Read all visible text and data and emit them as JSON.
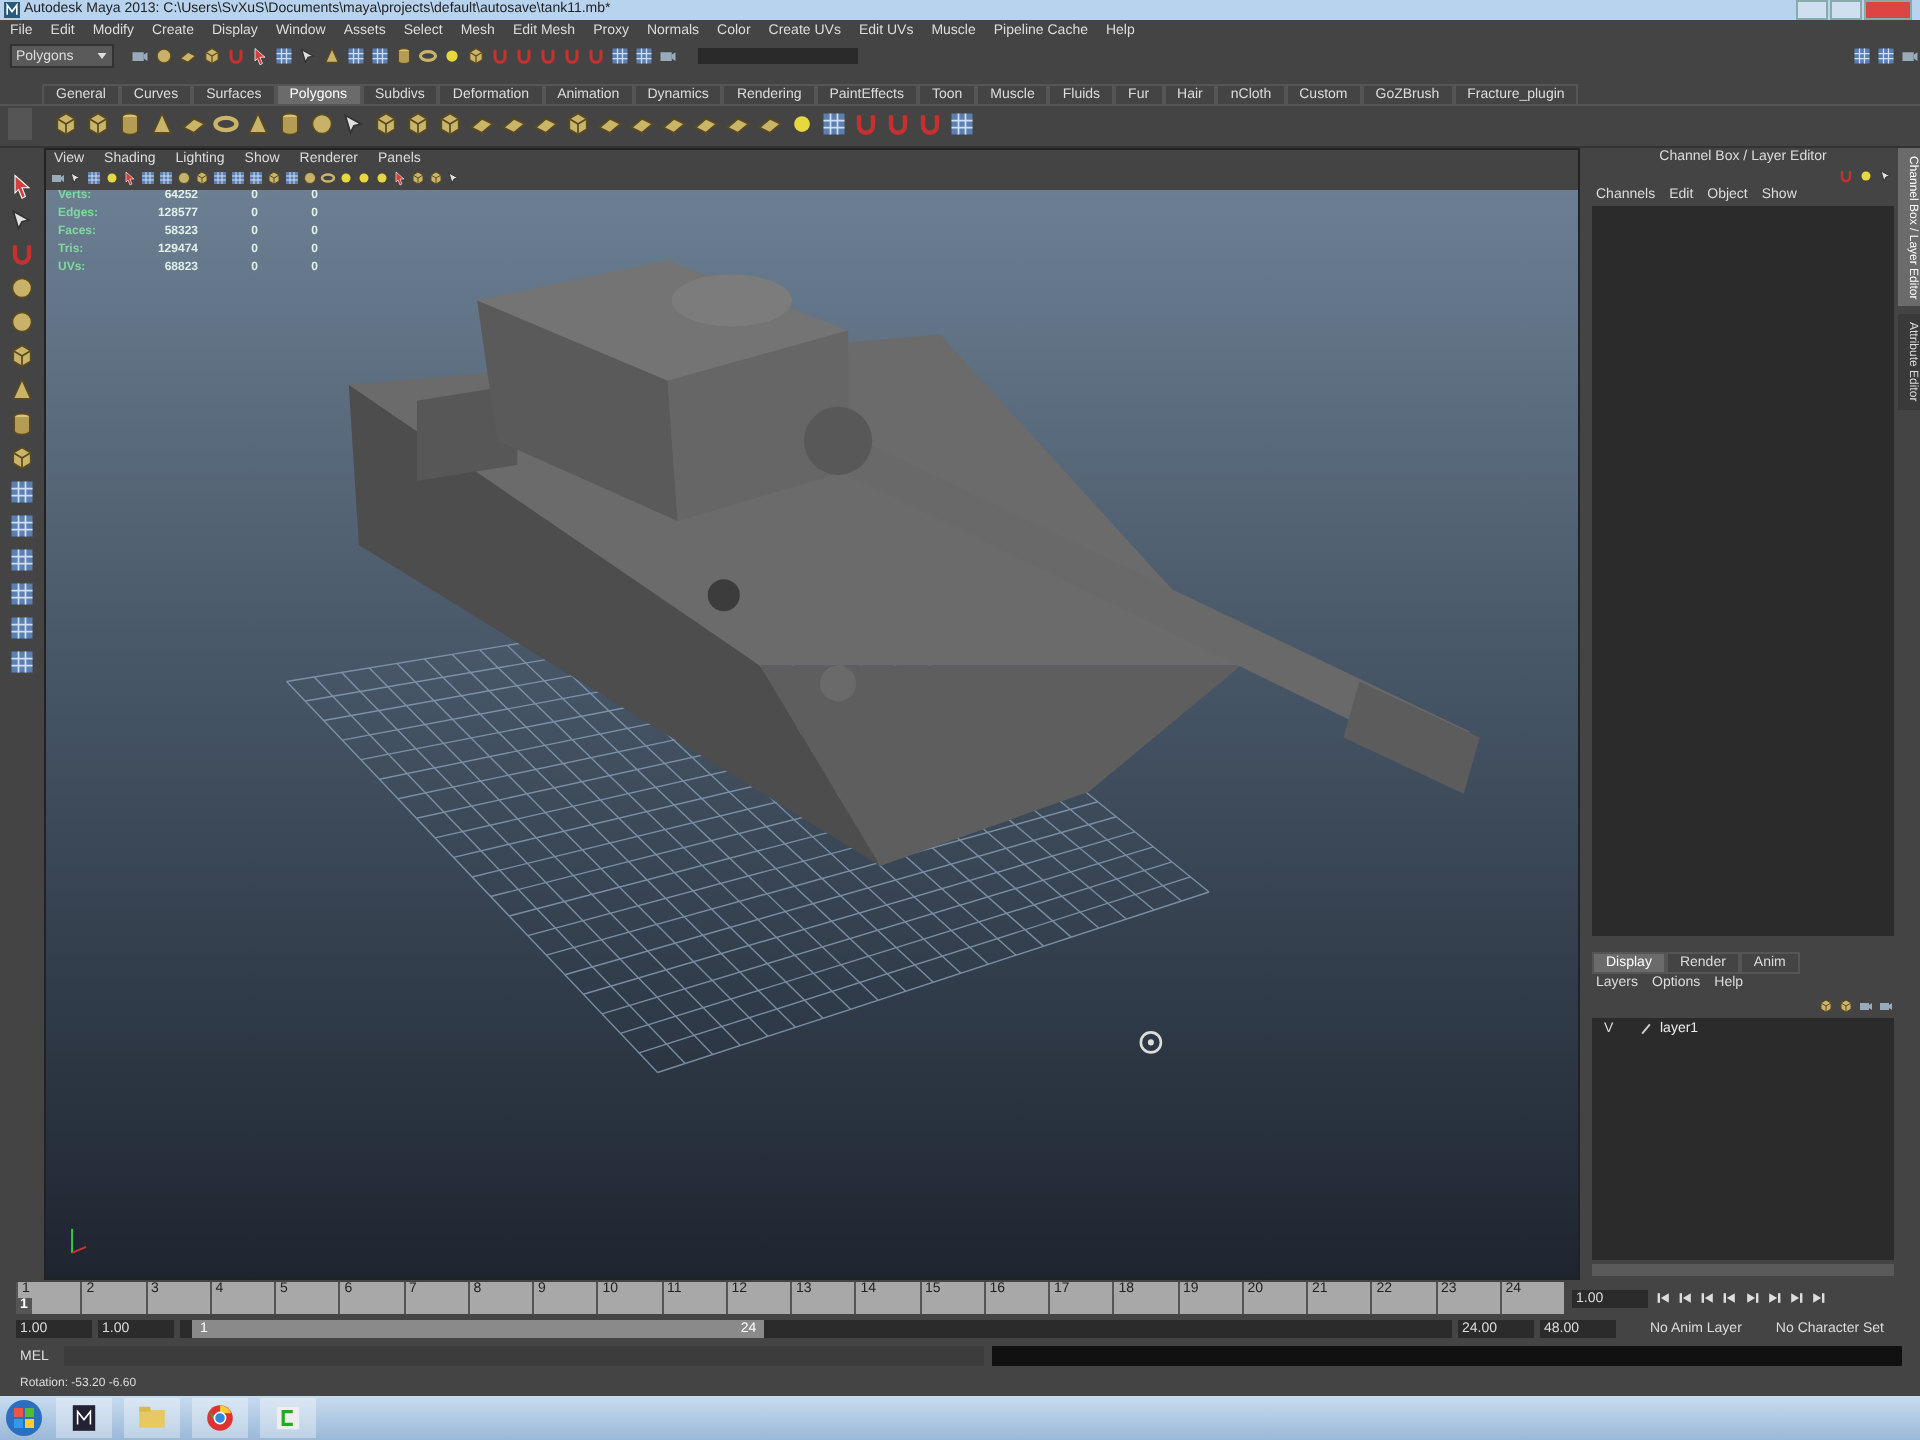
{
  "window": {
    "title": "Autodesk Maya 2013: C:\\Users\\SvXuS\\Documents\\maya\\projects\\default\\autosave\\tank11.mb*"
  },
  "menus": [
    "File",
    "Edit",
    "Modify",
    "Create",
    "Display",
    "Window",
    "Assets",
    "Select",
    "Mesh",
    "Edit Mesh",
    "Proxy",
    "Normals",
    "Color",
    "Create UVs",
    "Edit UVs",
    "Muscle",
    "Pipeline Cache",
    "Help"
  ],
  "status_line": {
    "mode": "Polygons"
  },
  "shelf_tabs": [
    {
      "label": "General",
      "selected": false
    },
    {
      "label": "Curves",
      "selected": false
    },
    {
      "label": "Surfaces",
      "selected": false
    },
    {
      "label": "Polygons",
      "selected": true
    },
    {
      "label": "Subdivs",
      "selected": false
    },
    {
      "label": "Deformation",
      "selected": false
    },
    {
      "label": "Animation",
      "selected": false
    },
    {
      "label": "Dynamics",
      "selected": false
    },
    {
      "label": "Rendering",
      "selected": false
    },
    {
      "label": "PaintEffects",
      "selected": false
    },
    {
      "label": "Toon",
      "selected": false
    },
    {
      "label": "Muscle",
      "selected": false
    },
    {
      "label": "Fluids",
      "selected": false
    },
    {
      "label": "Fur",
      "selected": false
    },
    {
      "label": "Hair",
      "selected": false
    },
    {
      "label": "nCloth",
      "selected": false
    },
    {
      "label": "Custom",
      "selected": false
    },
    {
      "label": "GoZBrush",
      "selected": false
    },
    {
      "label": "Fracture_plugin",
      "selected": false
    }
  ],
  "panel_menus": [
    "View",
    "Shading",
    "Lighting",
    "Show",
    "Renderer",
    "Panels"
  ],
  "hud": [
    {
      "label": "Verts:",
      "value": "64252",
      "column_2": "0",
      "column_3": "0"
    },
    {
      "label": "Edges:",
      "value": "128577",
      "column_2": "0",
      "column_3": "0"
    },
    {
      "label": "Faces:",
      "value": "58323",
      "column_2": "0",
      "column_3": "0"
    },
    {
      "label": "Tris:",
      "value": "129474",
      "column_2": "0",
      "column_3": "0"
    },
    {
      "label": "UVs:",
      "value": "68823",
      "column_2": "0",
      "column_3": "0"
    }
  ],
  "channel_box": {
    "title": "Channel Box / Layer Editor",
    "menus": [
      "Channels",
      "Edit",
      "Object",
      "Show"
    ]
  },
  "side_tabs": [
    {
      "label": "Channel Box / Layer Editor",
      "selected": true
    },
    {
      "label": "Attribute Editor",
      "selected": false
    }
  ],
  "layer_editor": {
    "tabs": [
      {
        "label": "Display",
        "selected": true
      },
      {
        "label": "Render",
        "selected": false
      },
      {
        "label": "Anim",
        "selected": false
      }
    ],
    "menus": [
      "Layers",
      "Options",
      "Help"
    ],
    "layers": [
      {
        "visibility": "V",
        "name": "layer1"
      }
    ]
  },
  "timeline": {
    "ticks": [
      "1",
      "2",
      "3",
      "4",
      "5",
      "6",
      "7",
      "8",
      "9",
      "10",
      "11",
      "12",
      "13",
      "14",
      "15",
      "16",
      "17",
      "18",
      "19",
      "20",
      "21",
      "22",
      "23",
      "24"
    ],
    "current_frame": "1",
    "level": 0,
    "current_time": "1.00"
  },
  "range": {
    "start": "1.00",
    "playback_start": "1.00",
    "handle_start": "1",
    "handle_end": "24",
    "level": 0.45,
    "playback_end": "24.00",
    "end": "48.00",
    "anim_layer": "No Anim Layer",
    "character_set": "No Character Set"
  },
  "command_line": {
    "label": "MEL"
  },
  "help_line": "Rotation:  -53.20   -6.60"
}
